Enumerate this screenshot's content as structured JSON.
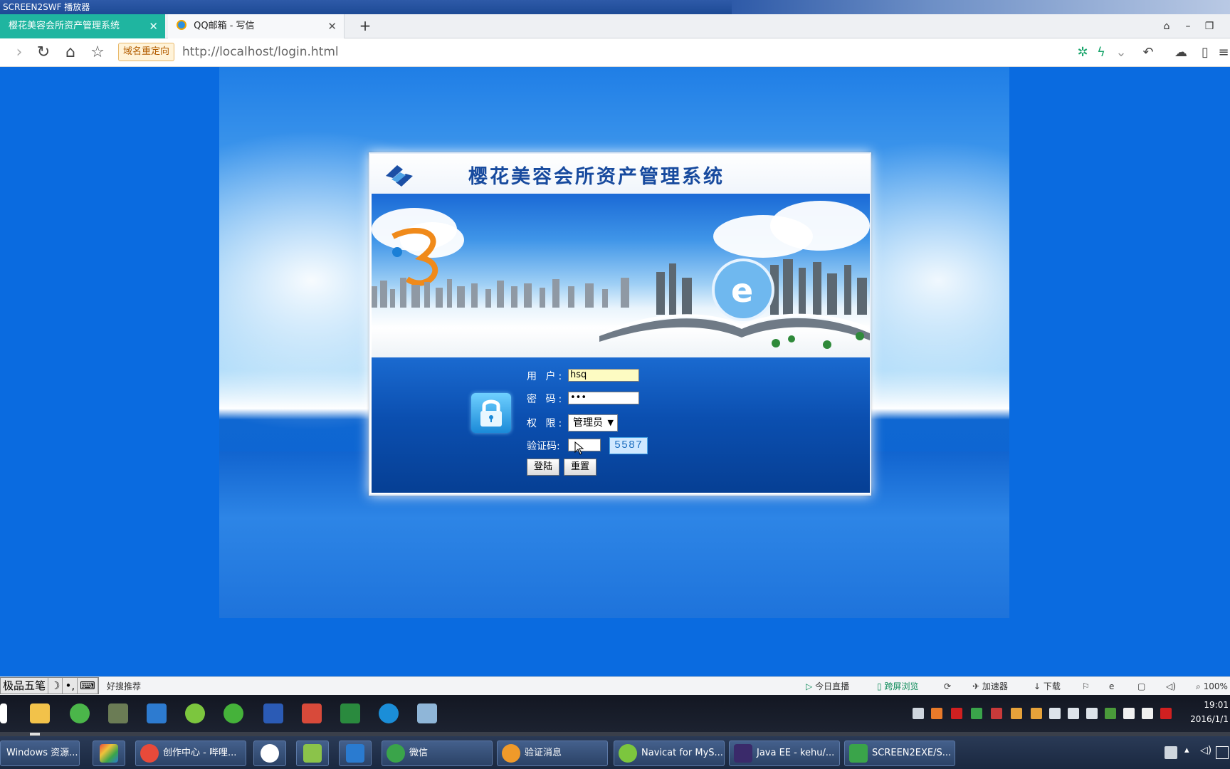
{
  "window": {
    "title": "SCREEN2SWF 播放器"
  },
  "browser": {
    "tabs": [
      {
        "label": "樱花美容会所资产管理系统",
        "active": true
      },
      {
        "label": "QQ邮箱 - 写信",
        "active": false
      }
    ],
    "redirect_badge": "域名重定向",
    "url": "http://localhost/login.html"
  },
  "login": {
    "system_title": "樱花美容会所资产管理系统",
    "labels": {
      "user": "用 户:",
      "password": "密 码:",
      "role": "权 限:",
      "captcha": "验证码:"
    },
    "username_value": "hsq",
    "password_value": "•••",
    "role_selected": "管理员",
    "captcha_input": "",
    "captcha_code": "5587",
    "login_button": "登陆",
    "reset_button": "重置"
  },
  "statusbar": {
    "ime": [
      "极品五笔",
      "☽",
      "•,",
      "⌨"
    ],
    "recommend": "好搜推荐",
    "items": [
      "今日直播",
      "跨屏浏览",
      "加速器",
      "下载",
      "100%"
    ]
  },
  "taskbar": {
    "clock_time": "19:01",
    "clock_date": "2016/1/1",
    "windows": [
      "Windows 资源...",
      "创作中心 - 哔哩...",
      "微信",
      "验证消息",
      "Navicat for MyS...",
      "Java EE - kehu/...",
      "SCREEN2EXE/S..."
    ]
  },
  "colors": {
    "tab_active": "#1fb5a0",
    "page_background": "#0a6be0",
    "title_blue": "#174a9e"
  }
}
